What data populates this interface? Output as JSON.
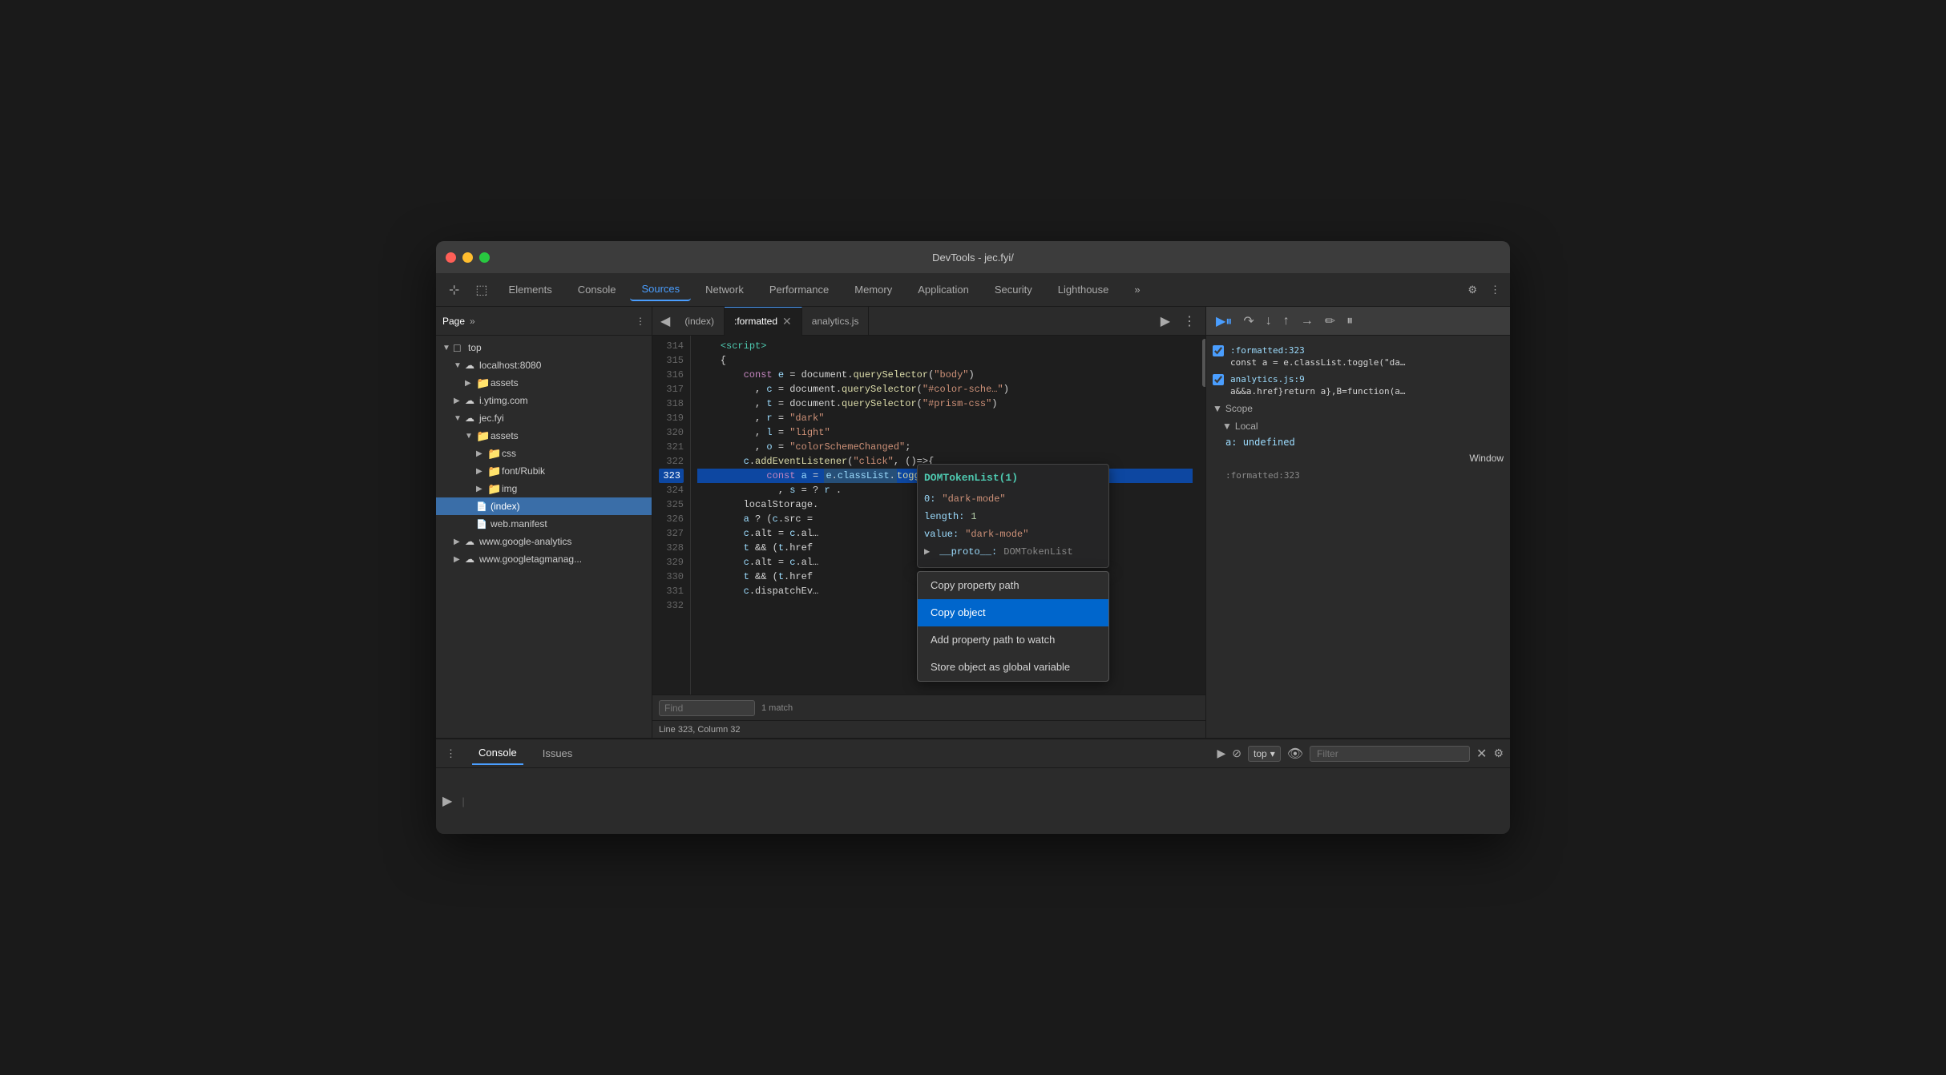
{
  "window": {
    "title": "DevTools - jec.fyi/"
  },
  "titlebar": {
    "title": "DevTools - jec.fyi/"
  },
  "tabs": [
    {
      "label": "Elements",
      "active": false
    },
    {
      "label": "Console",
      "active": false
    },
    {
      "label": "Sources",
      "active": true
    },
    {
      "label": "Network",
      "active": false
    },
    {
      "label": "Performance",
      "active": false
    },
    {
      "label": "Memory",
      "active": false
    },
    {
      "label": "Application",
      "active": false
    },
    {
      "label": "Security",
      "active": false
    },
    {
      "label": "Lighthouse",
      "active": false
    }
  ],
  "sidebar": {
    "page_label": "Page",
    "tree": [
      {
        "label": "top",
        "level": 0,
        "type": "root",
        "expanded": true
      },
      {
        "label": "localhost:8080",
        "level": 1,
        "type": "domain",
        "expanded": true
      },
      {
        "label": "assets",
        "level": 2,
        "type": "folder",
        "expanded": false
      },
      {
        "label": "i.ytimg.com",
        "level": 1,
        "type": "domain",
        "expanded": false
      },
      {
        "label": "jec.fyi",
        "level": 1,
        "type": "domain",
        "expanded": true
      },
      {
        "label": "assets",
        "level": 2,
        "type": "folder",
        "expanded": true
      },
      {
        "label": "css",
        "level": 3,
        "type": "folder",
        "expanded": false
      },
      {
        "label": "font/Rubik",
        "level": 3,
        "type": "folder",
        "expanded": false
      },
      {
        "label": "img",
        "level": 3,
        "type": "folder",
        "expanded": false
      },
      {
        "label": "(index)",
        "level": 2,
        "type": "file",
        "selected": true
      },
      {
        "label": "web.manifest",
        "level": 2,
        "type": "file"
      },
      {
        "label": "www.google-analytics",
        "level": 1,
        "type": "domain",
        "expanded": false
      },
      {
        "label": "www.googletagmanag...",
        "level": 1,
        "type": "domain",
        "expanded": false
      }
    ]
  },
  "editor": {
    "tabs": [
      {
        "label": "(index)",
        "active": false
      },
      {
        "label": ":formatted",
        "active": true,
        "closeable": true
      },
      {
        "label": "analytics.js",
        "active": false
      }
    ],
    "lines": [
      {
        "num": 314,
        "code": "    <script>",
        "highlight": false
      },
      {
        "num": 315,
        "code": "    {",
        "highlight": false
      },
      {
        "num": 316,
        "code": "        const e = document.querySelector(\"body\")",
        "highlight": false
      },
      {
        "num": 317,
        "code": "          , c = document.querySelector(\"#color-sche…",
        "highlight": false
      },
      {
        "num": 318,
        "code": "          , t = document.querySelector(\"#prism-css\")",
        "highlight": false
      },
      {
        "num": 319,
        "code": "          , r = \"dark\"",
        "highlight": false
      },
      {
        "num": 320,
        "code": "          , l = \"light\"",
        "highlight": false
      },
      {
        "num": 321,
        "code": "          , o = \"colorSchemeChanged\";",
        "highlight": false
      },
      {
        "num": 322,
        "code": "        c.addEventListener(\"click\", ()=>{",
        "highlight": false
      },
      {
        "num": 323,
        "code": "            const a = e.classList.toggle(\"dark-mo…",
        "highlight": true,
        "current": true
      },
      {
        "num": 324,
        "code": "              , s = ? r .",
        "highlight": false
      },
      {
        "num": 325,
        "code": "        localStorage.",
        "highlight": false
      },
      {
        "num": 326,
        "code": "        a ? (c.src =",
        "highlight": false
      },
      {
        "num": 327,
        "code": "        c.alt = c.al…",
        "highlight": false
      },
      {
        "num": 328,
        "code": "        t && (t.href",
        "highlight": false
      },
      {
        "num": 329,
        "code": "        c.alt = c.al…",
        "highlight": false
      },
      {
        "num": 330,
        "code": "        t && (t.href",
        "highlight": false
      },
      {
        "num": 331,
        "code": "        c.dispatchEv…",
        "highlight": false
      },
      {
        "num": 332,
        "code": "",
        "highlight": false
      }
    ],
    "status": "Line 323, Column 32",
    "search": {
      "placeholder": "Find",
      "match_count": "1 match"
    }
  },
  "tooltip": {
    "title": "DOMTokenList(1)",
    "props": [
      {
        "key": "0:",
        "val": "\"dark-mode\""
      },
      {
        "key": "length:",
        "val": "1"
      },
      {
        "key": "value:",
        "val": "\"dark-mode\""
      },
      {
        "key": "__proto__:",
        "val": "DOMTokenList",
        "is_proto": true
      }
    ]
  },
  "context_menu": {
    "items": [
      {
        "label": "Copy property path",
        "selected": false
      },
      {
        "label": "Copy object",
        "selected": true
      },
      {
        "label": "Add property path to watch",
        "selected": false
      },
      {
        "label": "Store object as global variable",
        "selected": false
      }
    ]
  },
  "debugger": {
    "breakpoints": [
      {
        "file": ":formatted:323",
        "code": "const a = e.classList.toggle(\"da…",
        "checked": true
      },
      {
        "file": "analytics.js:9",
        "code": "a&&a.href}return a},B=function(a…",
        "checked": true
      }
    ],
    "scope": {
      "title": "Scope",
      "sections": [
        {
          "label": "Local",
          "items": [
            {
              "key": "a:",
              "val": "undefined"
            }
          ]
        }
      ]
    },
    "call_stack": {
      "title": "Window",
      "file_ref": ":formatted:323"
    }
  },
  "console": {
    "tabs": [
      {
        "label": "Console",
        "active": true
      },
      {
        "label": "Issues",
        "active": false
      }
    ],
    "top_selector": "top",
    "filter_placeholder": "Filter"
  }
}
